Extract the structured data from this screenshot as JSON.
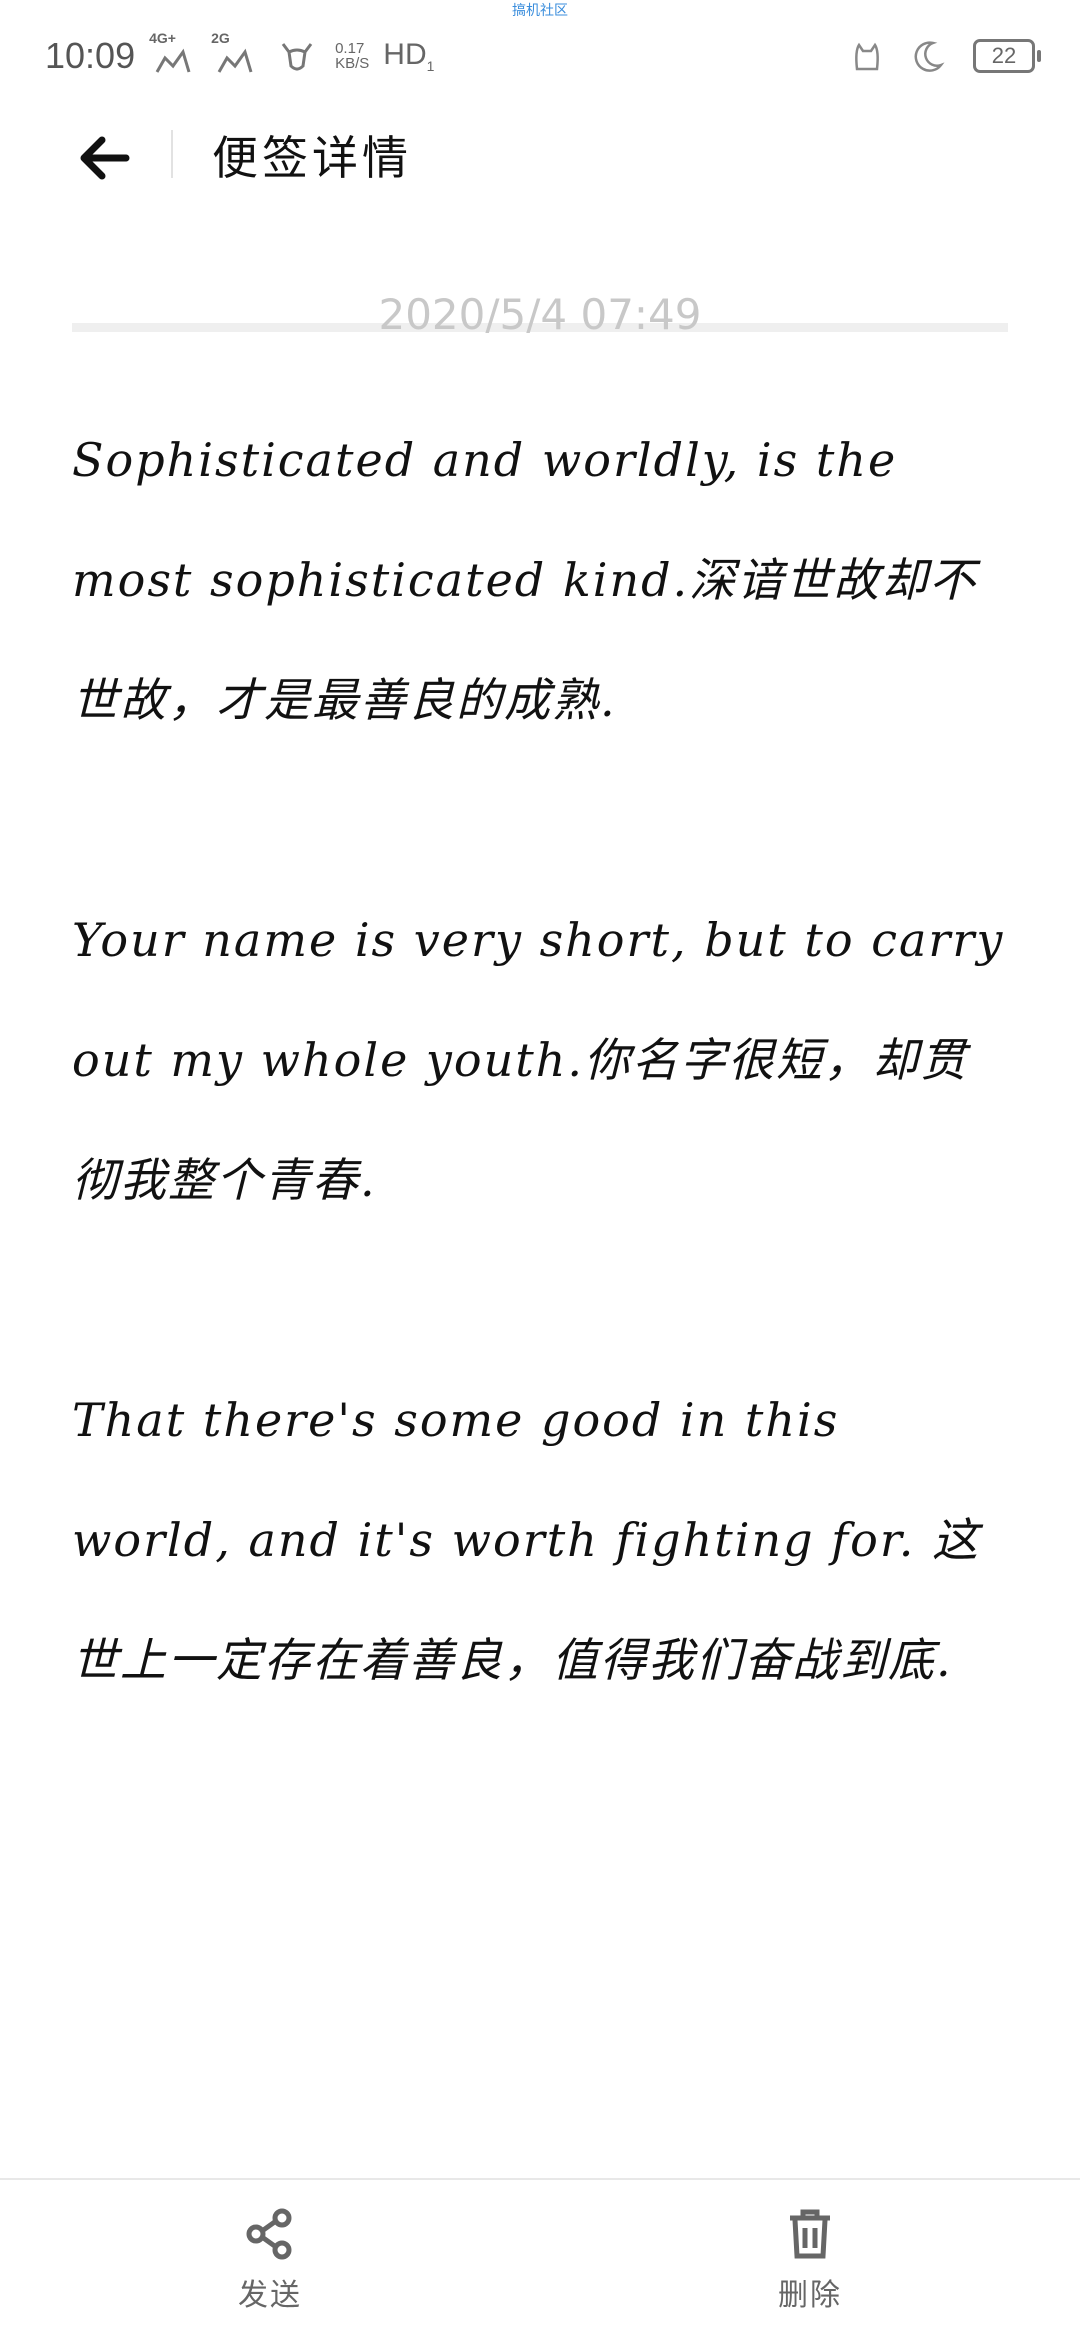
{
  "status_bar": {
    "top_label": "搞机社区",
    "time": "10:09",
    "network_1": "4G+",
    "network_2": "2G",
    "speed_value": "0.17",
    "speed_unit": "KB/S",
    "hd_label": "HD",
    "hd_sub": "1",
    "battery": "22"
  },
  "header": {
    "title": "便签详情"
  },
  "note": {
    "timestamp": "2020/5/4 07:49",
    "paragraphs": [
      "Sophisticated and worldly, is the most sophisticated kind.深谙世故却不世故，才是最善良的成熟.",
      "Your name is very short, but to carry out my whole youth.你名字很短，却贯彻我整个青春.",
      "That there's some good in this world, and it's worth fighting for. 这世上一定存在着善良，值得我们奋战到底."
    ]
  },
  "bottom_bar": {
    "send_label": "发送",
    "delete_label": "删除"
  },
  "colors": {
    "accent_status": "#3a8ddc",
    "timestamp": "#c8c8c8",
    "icon": "#666666"
  },
  "icons": {
    "back": "arrow-left-icon",
    "send": "share-icon",
    "delete": "trash-icon"
  }
}
